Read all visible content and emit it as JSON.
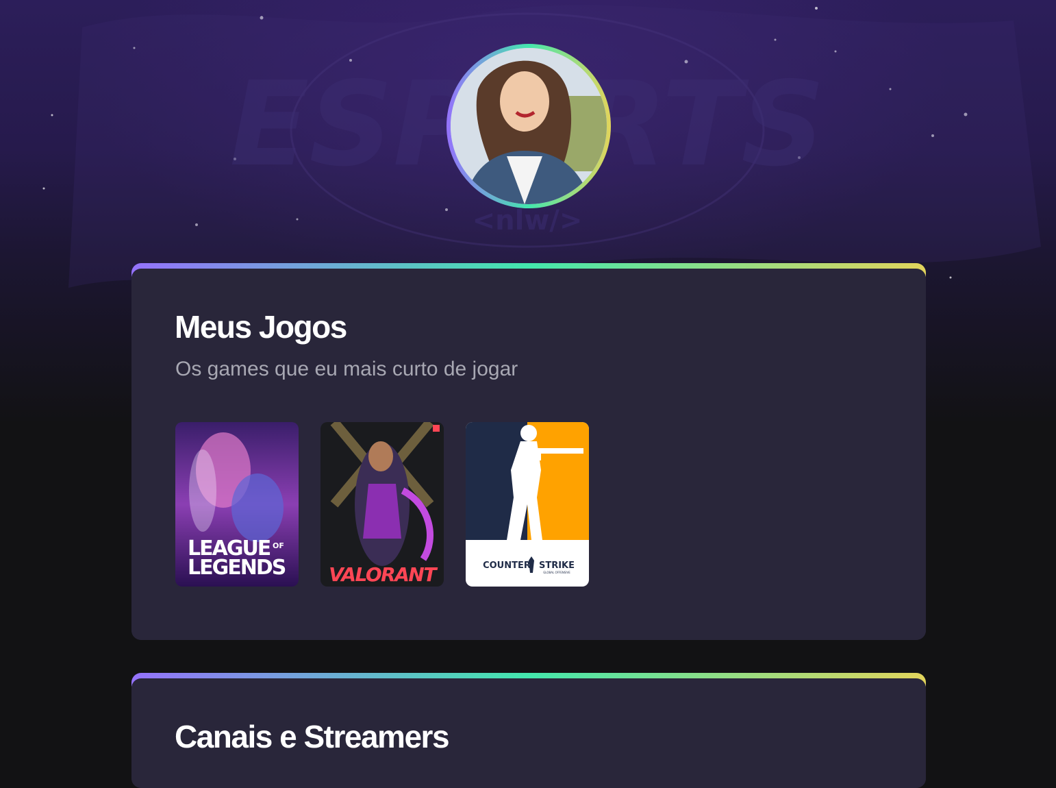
{
  "profile": {
    "avatar_alt": "Foto de perfil"
  },
  "games_section": {
    "title": "Meus Jogos",
    "subtitle": "Os games que eu mais curto de jogar",
    "games": [
      {
        "name": "League of Legends",
        "logo_line1": "LEAGUE",
        "logo_of": "OF",
        "logo_line2": "LEGENDS"
      },
      {
        "name": "Valorant",
        "logo": "VALORANT"
      },
      {
        "name": "Counter Strike",
        "logo_left": "COUNTER",
        "logo_right": "STRIKE",
        "logo_sub": "GLOBAL OFFENSIVE"
      }
    ]
  },
  "streamers_section": {
    "title": "Canais e Streamers"
  },
  "colors": {
    "background": "#121214",
    "card": "#29263a",
    "gradient": [
      "#9572fc",
      "#43e7ad",
      "#e2d45c"
    ],
    "subtitle": "#a8a8b3"
  }
}
